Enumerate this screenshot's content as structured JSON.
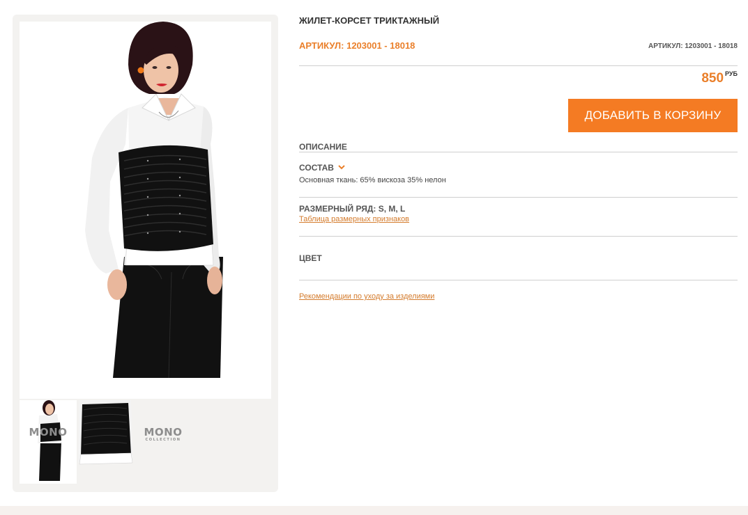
{
  "product": {
    "title": "ЖИЛЕТ-КОРСЕТ ТРИКТАЖНЫЙ",
    "sku_main": "АРТИКУЛ: 1203001 - 18018",
    "sku_right": "АРТИКУЛ: 1203001 - 18018",
    "price": "850",
    "currency": "РУБ",
    "add_to_cart_label": "ДОБАВИТЬ В КОРЗИНУ"
  },
  "description": {
    "heading": "ОПИСАНИЕ",
    "composition_label": "СОСТАВ",
    "composition_text": "Основная ткань: 65% вискоза 35% нелон",
    "size_range_label": "РАЗМЕРНЫЙ РЯД: S, M, L",
    "size_table_link": "Таблица размерных признаков",
    "color_label": "ЦВЕТ",
    "care_link": "Рекомендации по уходу за изделиями"
  },
  "gallery": {
    "thumbnails": [
      {
        "name": "full-outfit"
      },
      {
        "name": "corset-detail"
      },
      {
        "name": "logo"
      }
    ],
    "logo_text": "MONO",
    "logo_subtext": "COLLECTION"
  },
  "colors": {
    "accent": "#f47b23",
    "accent_text": "#ea7f2a",
    "link": "#d47b2c",
    "gallery_bg": "#f3f2f0"
  }
}
